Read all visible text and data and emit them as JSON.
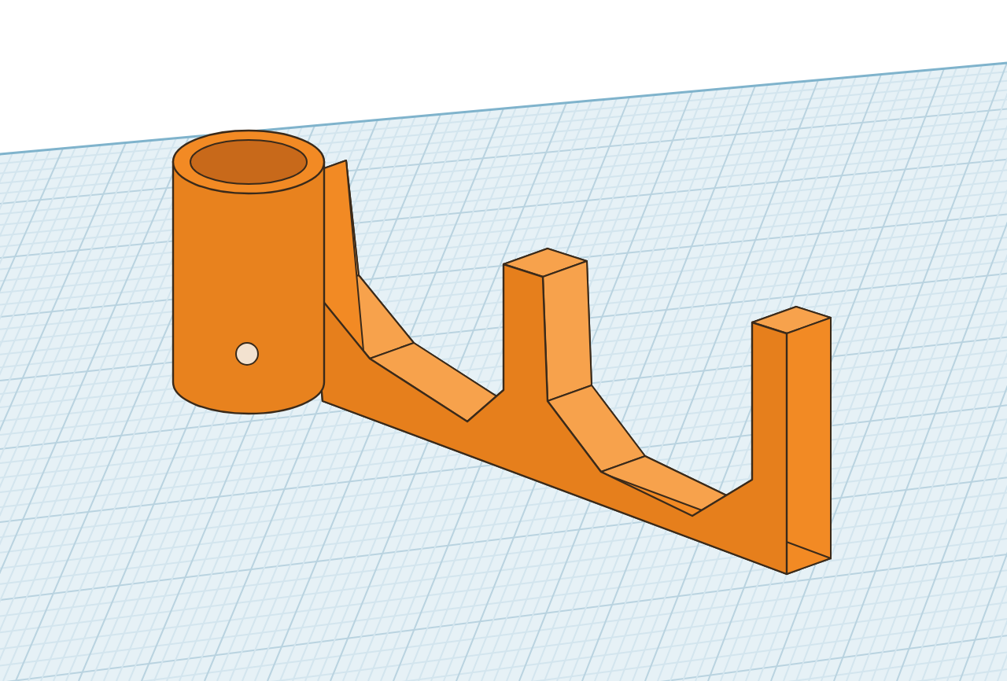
{
  "viewport": {
    "kind": "workplane",
    "grid": true
  }
}
